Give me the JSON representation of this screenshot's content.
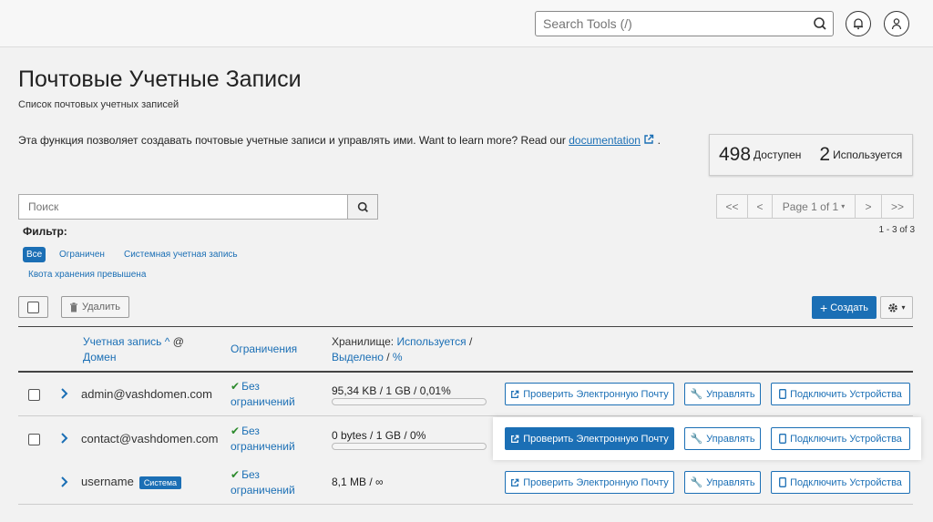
{
  "topbar": {
    "search_placeholder": "Search Tools (/)",
    "icons": [
      "search-icon",
      "bell-icon",
      "user-icon"
    ]
  },
  "page": {
    "title": "Почтовые Учетные Записи",
    "subtitle": "Список почтовых учетных записей",
    "intro_text": "Эта функция позволяет создавать почтовые учетные записи и управлять ими. Want to learn more? Read our",
    "intro_link": "documentation",
    "intro_end": "."
  },
  "stats": {
    "available_num": "498",
    "available_label": "Доступен",
    "used_num": "2",
    "used_label": "Используется"
  },
  "filter": {
    "search_placeholder": "Поиск",
    "label": "Фильтр:",
    "pills": [
      "Все",
      "Ограничен",
      "Системная учетная запись",
      "Квота хранения превышена"
    ],
    "count": "1 - 3 of 3"
  },
  "pager": {
    "first": "<<",
    "prev": "<",
    "page": "Page 1 of 1",
    "next": ">",
    "last": ">>"
  },
  "actions": {
    "delete": "Удалить",
    "create": "Создать"
  },
  "table": {
    "headers": {
      "account": "Учетная запись",
      "at": "@",
      "domain": "Домен",
      "limits": "Ограничения",
      "storage_prefix": "Хранилище:",
      "storage_used": "Используется",
      "slash": "/",
      "storage_alloc": "Выделено",
      "storage_pct": "%"
    },
    "rows": [
      {
        "account": "admin@vashdomen.com",
        "limit_line1": "Без",
        "limit_line2": "ограничений",
        "storage": "95,34 KB / 1 GB / 0,01%",
        "usage": 0.0001,
        "check": "Проверить Электронную Почту",
        "manage": "Управлять",
        "devices": "Подключить Устройства"
      },
      {
        "account": "contact@vashdomen.com",
        "limit_line1": "Без",
        "limit_line2": "ограничений",
        "storage": "0 bytes / 1 GB / 0%",
        "usage": 0,
        "check": "Проверить Электронную Почту",
        "manage": "Управлять",
        "devices": "Подключить Устройства"
      },
      {
        "account": "username",
        "badge": "Система",
        "limit_line1": "Без",
        "limit_line2": "ограничений",
        "storage": "8,1 MB / ∞",
        "check": "Проверить Электронную Почту",
        "manage": "Управлять",
        "devices": "Подключить Устройства"
      }
    ]
  },
  "colors": {
    "accent": "#1b6fb5",
    "success": "#2c8a2c"
  }
}
